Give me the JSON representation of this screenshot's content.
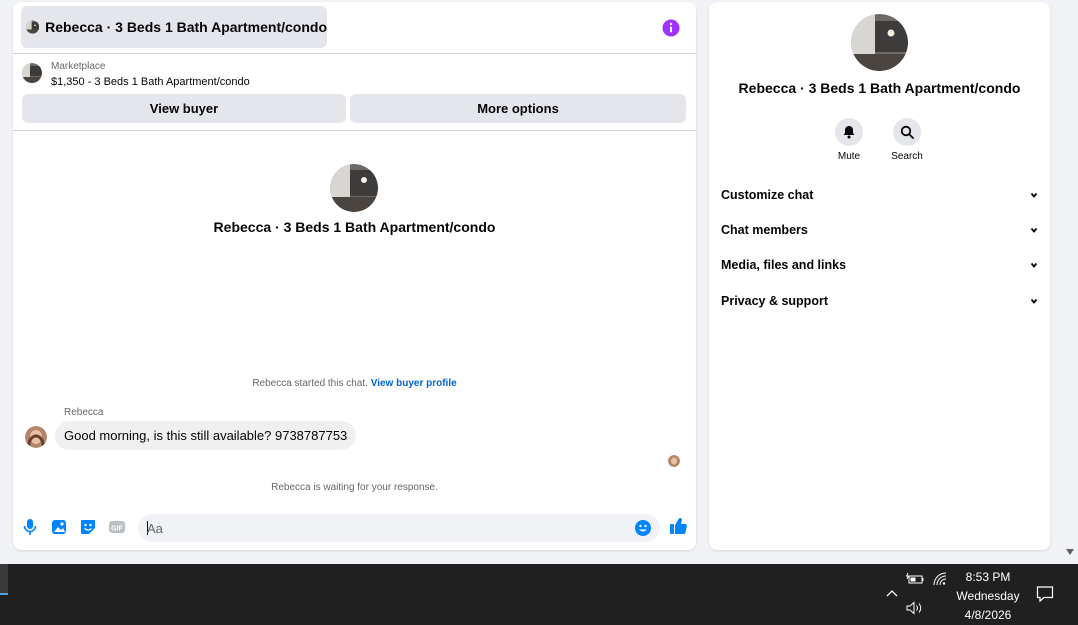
{
  "chat": {
    "title": "Rebecca · 3 Beds 1 Bath Apartment/condo",
    "listing": {
      "source": "Marketplace",
      "summary": "$1,350 - 3 Beds 1 Bath Apartment/condo"
    },
    "buttons": {
      "view_buyer": "View buyer",
      "more_options": "More options"
    },
    "center_title": "Rebecca · 3 Beds 1 Bath Apartment/condo",
    "started_text": "Rebecca started this chat.",
    "view_profile_link": "View buyer profile",
    "messages": [
      {
        "sender": "Rebecca",
        "text": "Good morning, is this still available? 9738787753"
      }
    ],
    "waiting_text": "Rebecca is waiting for your response.",
    "composer": {
      "placeholder": "Aa"
    }
  },
  "side": {
    "title": "Rebecca · 3 Beds 1 Bath Apartment/condo",
    "actions": [
      {
        "label": "Mute",
        "icon": "bell-icon"
      },
      {
        "label": "Search",
        "icon": "search-icon"
      }
    ],
    "sections": [
      {
        "label": "Customize chat"
      },
      {
        "label": "Chat members"
      },
      {
        "label": "Media, files and links"
      },
      {
        "label": "Privacy & support"
      }
    ]
  },
  "taskbar": {
    "time": "8:53 PM",
    "day": "Wednesday",
    "date": "4/8/2026"
  },
  "colors": {
    "accent": "#0084ff",
    "info": "#a033ff",
    "link": "#0064d1",
    "taskbar": "#202020"
  }
}
